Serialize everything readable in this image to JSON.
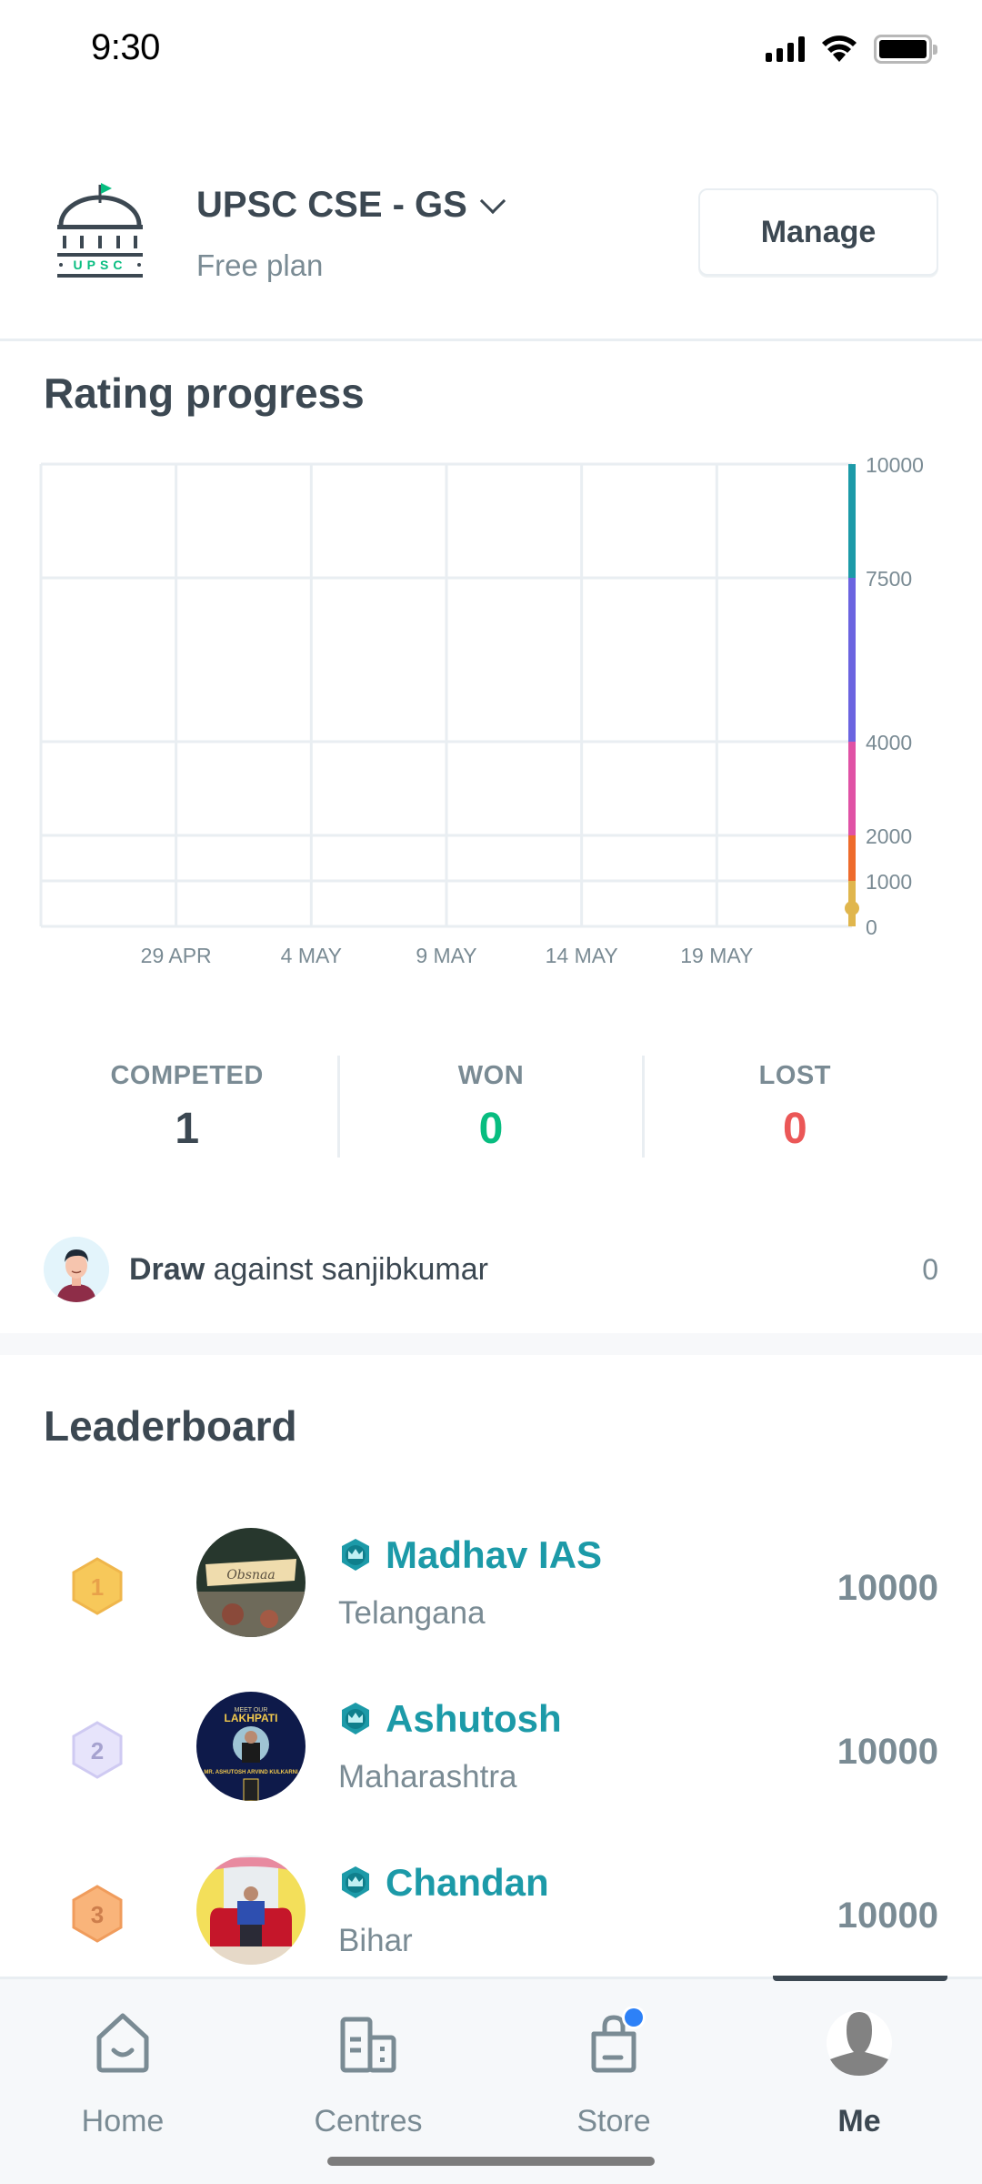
{
  "status_bar": {
    "time": "9:30",
    "icons": [
      "cellular-signal-icon",
      "wifi-icon",
      "battery-icon"
    ]
  },
  "header": {
    "logo_text": "UPSC",
    "goal_title": "UPSC CSE - GS",
    "plan": "Free plan",
    "manage_label": "Manage"
  },
  "rating": {
    "title": "Rating progress",
    "chart_data": {
      "type": "line",
      "title": "Rating progress",
      "xlabel": "",
      "ylabel": "",
      "x_ticks": [
        "29 APR",
        "4 MAY",
        "9 MAY",
        "14 MAY",
        "19 MAY"
      ],
      "y_ticks": [
        0,
        1000,
        2000,
        4000,
        7500,
        10000
      ],
      "ylim": [
        0,
        10000
      ],
      "grid": true,
      "series": [],
      "current_rating": 400,
      "rating_bands": [
        {
          "from": 0,
          "to": 1000,
          "color": "#e0b64d"
        },
        {
          "from": 1000,
          "to": 2000,
          "color": "#ee6b2c"
        },
        {
          "from": 2000,
          "to": 4000,
          "color": "#e052a5"
        },
        {
          "from": 4000,
          "to": 7500,
          "color": "#6b64e0"
        },
        {
          "from": 7500,
          "to": 10000,
          "color": "#1c9aa8"
        }
      ]
    }
  },
  "stats": {
    "competed_label": "COMPETED",
    "competed": "1",
    "won_label": "WON",
    "won": "0",
    "lost_label": "LOST",
    "lost": "0"
  },
  "match": {
    "result": "Draw",
    "against_text": " against sanjibkumar",
    "score": "0"
  },
  "leaderboard": {
    "title": "Leaderboard",
    "rows": [
      {
        "rank": "1",
        "name": "Madhav IAS",
        "state": "Telangana",
        "score": "10000"
      },
      {
        "rank": "2",
        "name": "Ashutosh",
        "state": "Maharashtra",
        "score": "10000"
      },
      {
        "rank": "3",
        "name": "Chandan",
        "state": "Bihar",
        "score": "10000"
      }
    ]
  },
  "nav": {
    "items": [
      {
        "label": "Home"
      },
      {
        "label": "Centres"
      },
      {
        "label": "Store"
      },
      {
        "label": "Me"
      }
    ],
    "active": "Me",
    "store_badge_color": "#2d81f7"
  }
}
